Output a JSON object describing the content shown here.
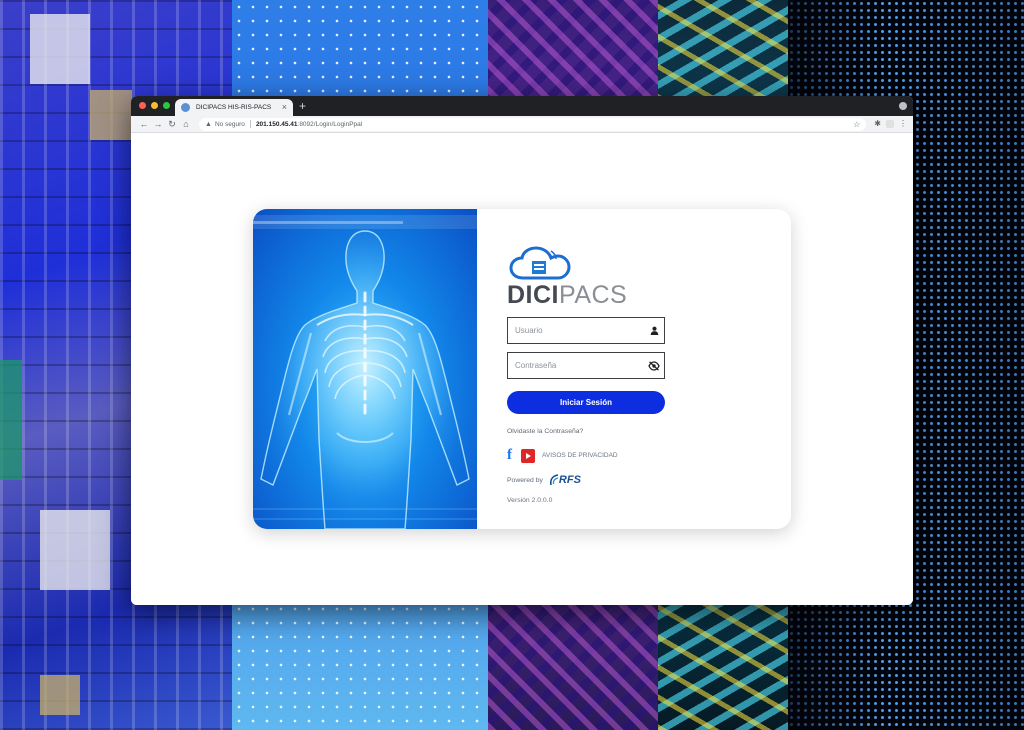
{
  "browser": {
    "tab_title": "DICIPACS HIS-RIS-PACS",
    "security_label": "No seguro",
    "url_host": "201.150.45.41",
    "url_path": ":8092/Login/LoginPpal"
  },
  "brand": {
    "name_bold": "DICI",
    "name_light": "PACS",
    "accent": "#0d2de0"
  },
  "login": {
    "username_placeholder": "Usuario",
    "password_placeholder": "Contraseña",
    "submit_label": "Iniciar Sesión",
    "forgot_link": "Olvidaste la Contraseña?",
    "privacy_link": "AVISOS DE PRIVACIDAD",
    "powered_by": "Powered by",
    "partner_logo": "RFS",
    "version": "Versión 2.0.0.0"
  },
  "icons": {
    "user": "user-icon",
    "password_toggle": "eye-off-icon",
    "facebook": "facebook-icon",
    "youtube": "youtube-icon"
  }
}
